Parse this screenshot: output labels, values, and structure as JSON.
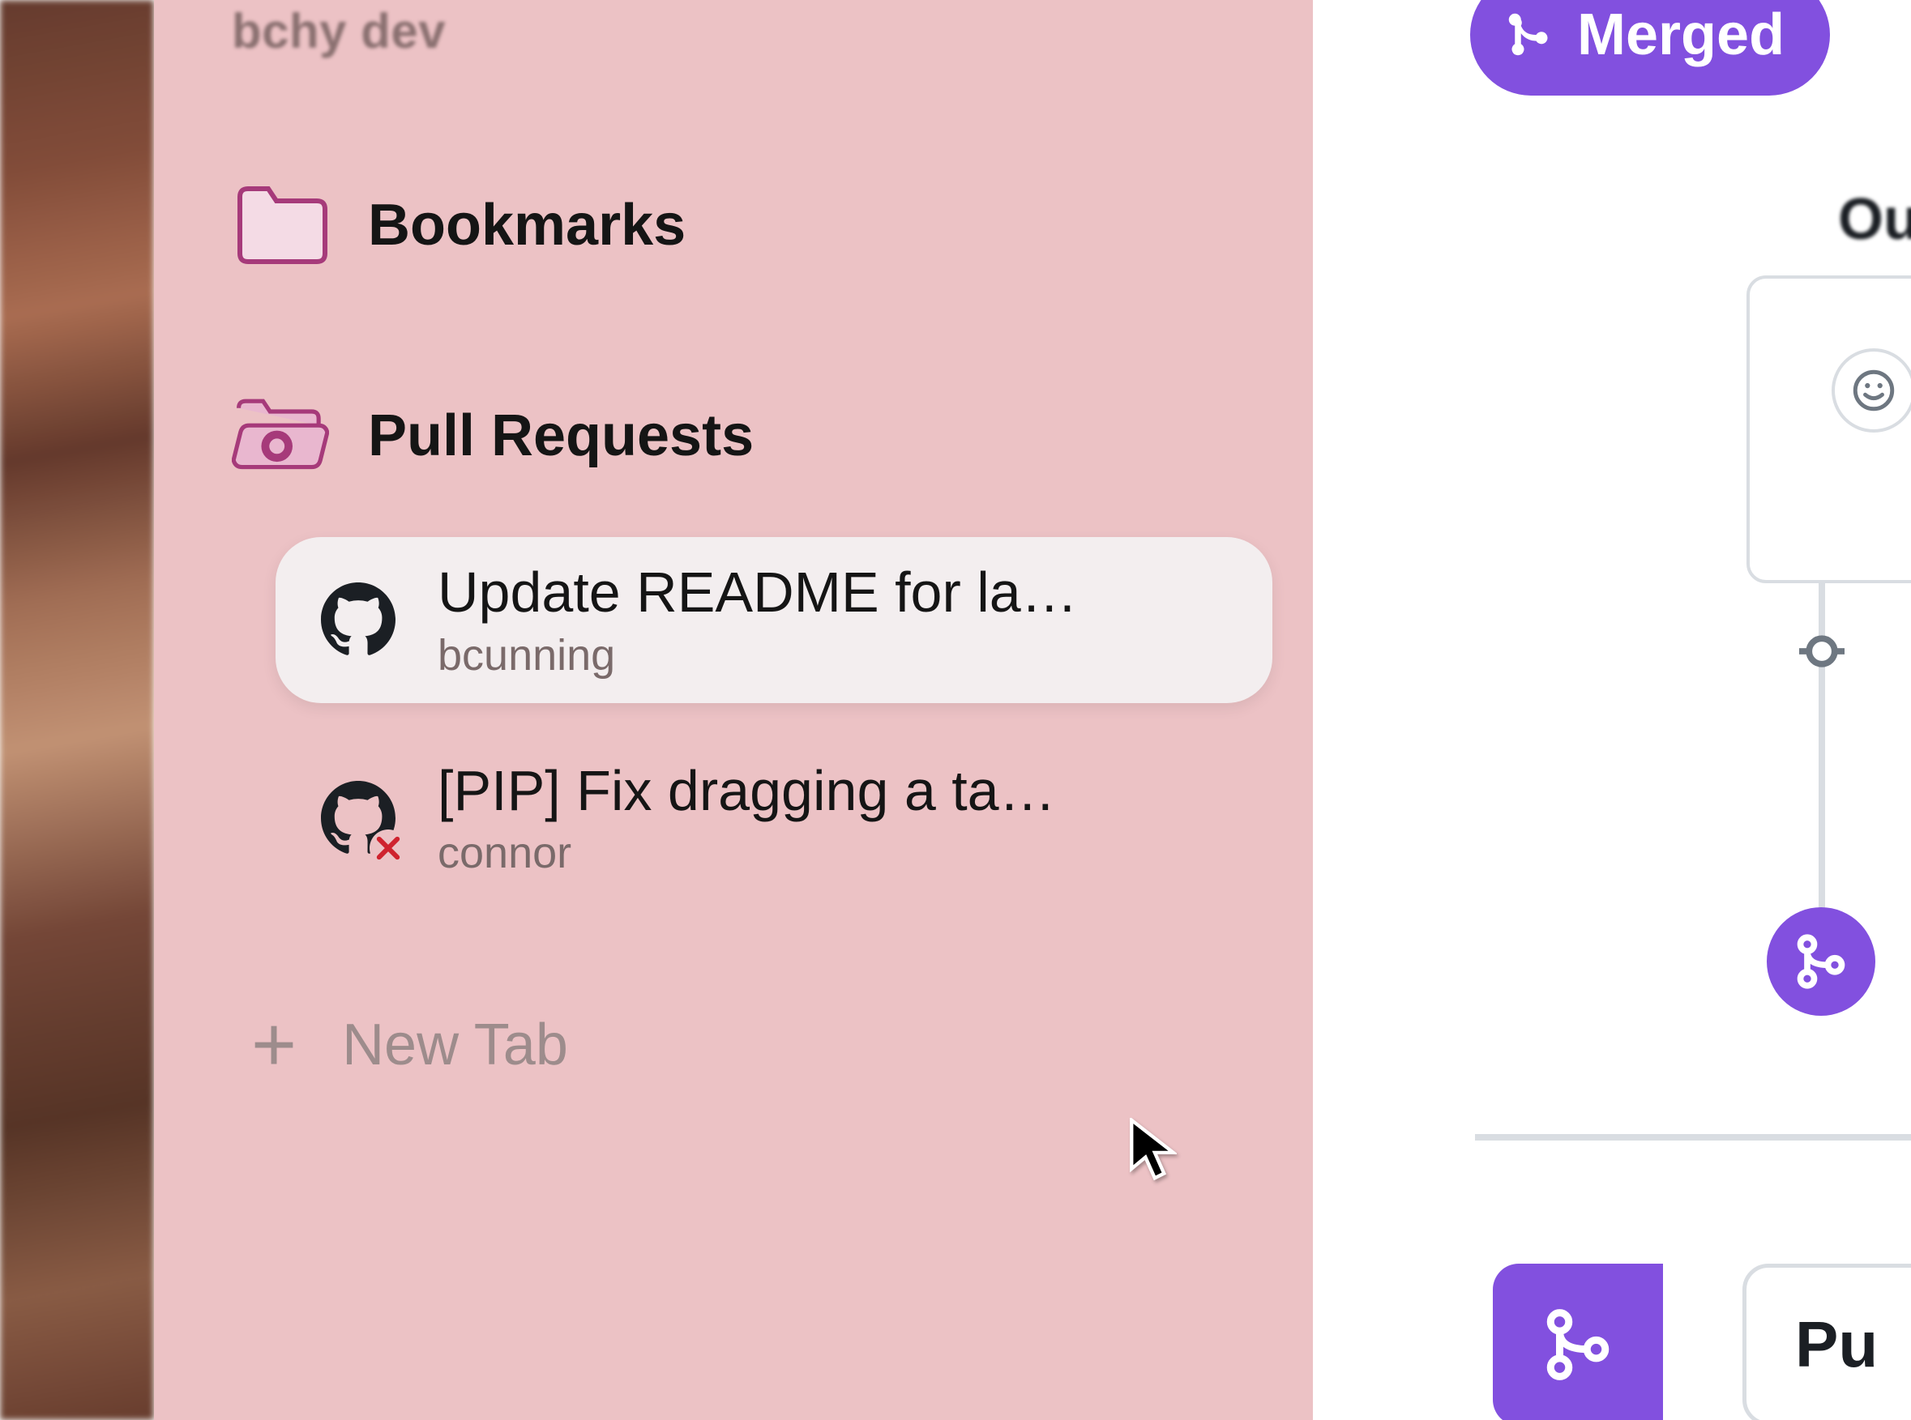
{
  "sidebar": {
    "workspace_title": "bchy dev",
    "sections": {
      "bookmarks_label": "Bookmarks",
      "pull_requests_label": "Pull Requests"
    },
    "pull_requests": [
      {
        "title": "Update README for la…",
        "author": "bcunning",
        "status": "open",
        "active": true
      },
      {
        "title": "[PIP] Fix dragging a ta…",
        "author": "connor",
        "status": "closed",
        "active": false
      }
    ],
    "new_tab_label": "New Tab"
  },
  "content": {
    "merged_badge": "Merged",
    "top_partial_text": "Ou",
    "bottom_partial_text": "Pu"
  },
  "colors": {
    "sidebar_bg": "#ecc2c5",
    "accent_purple": "#8250df",
    "closed_red": "#cf222e",
    "border_gray": "#d9dde2"
  }
}
